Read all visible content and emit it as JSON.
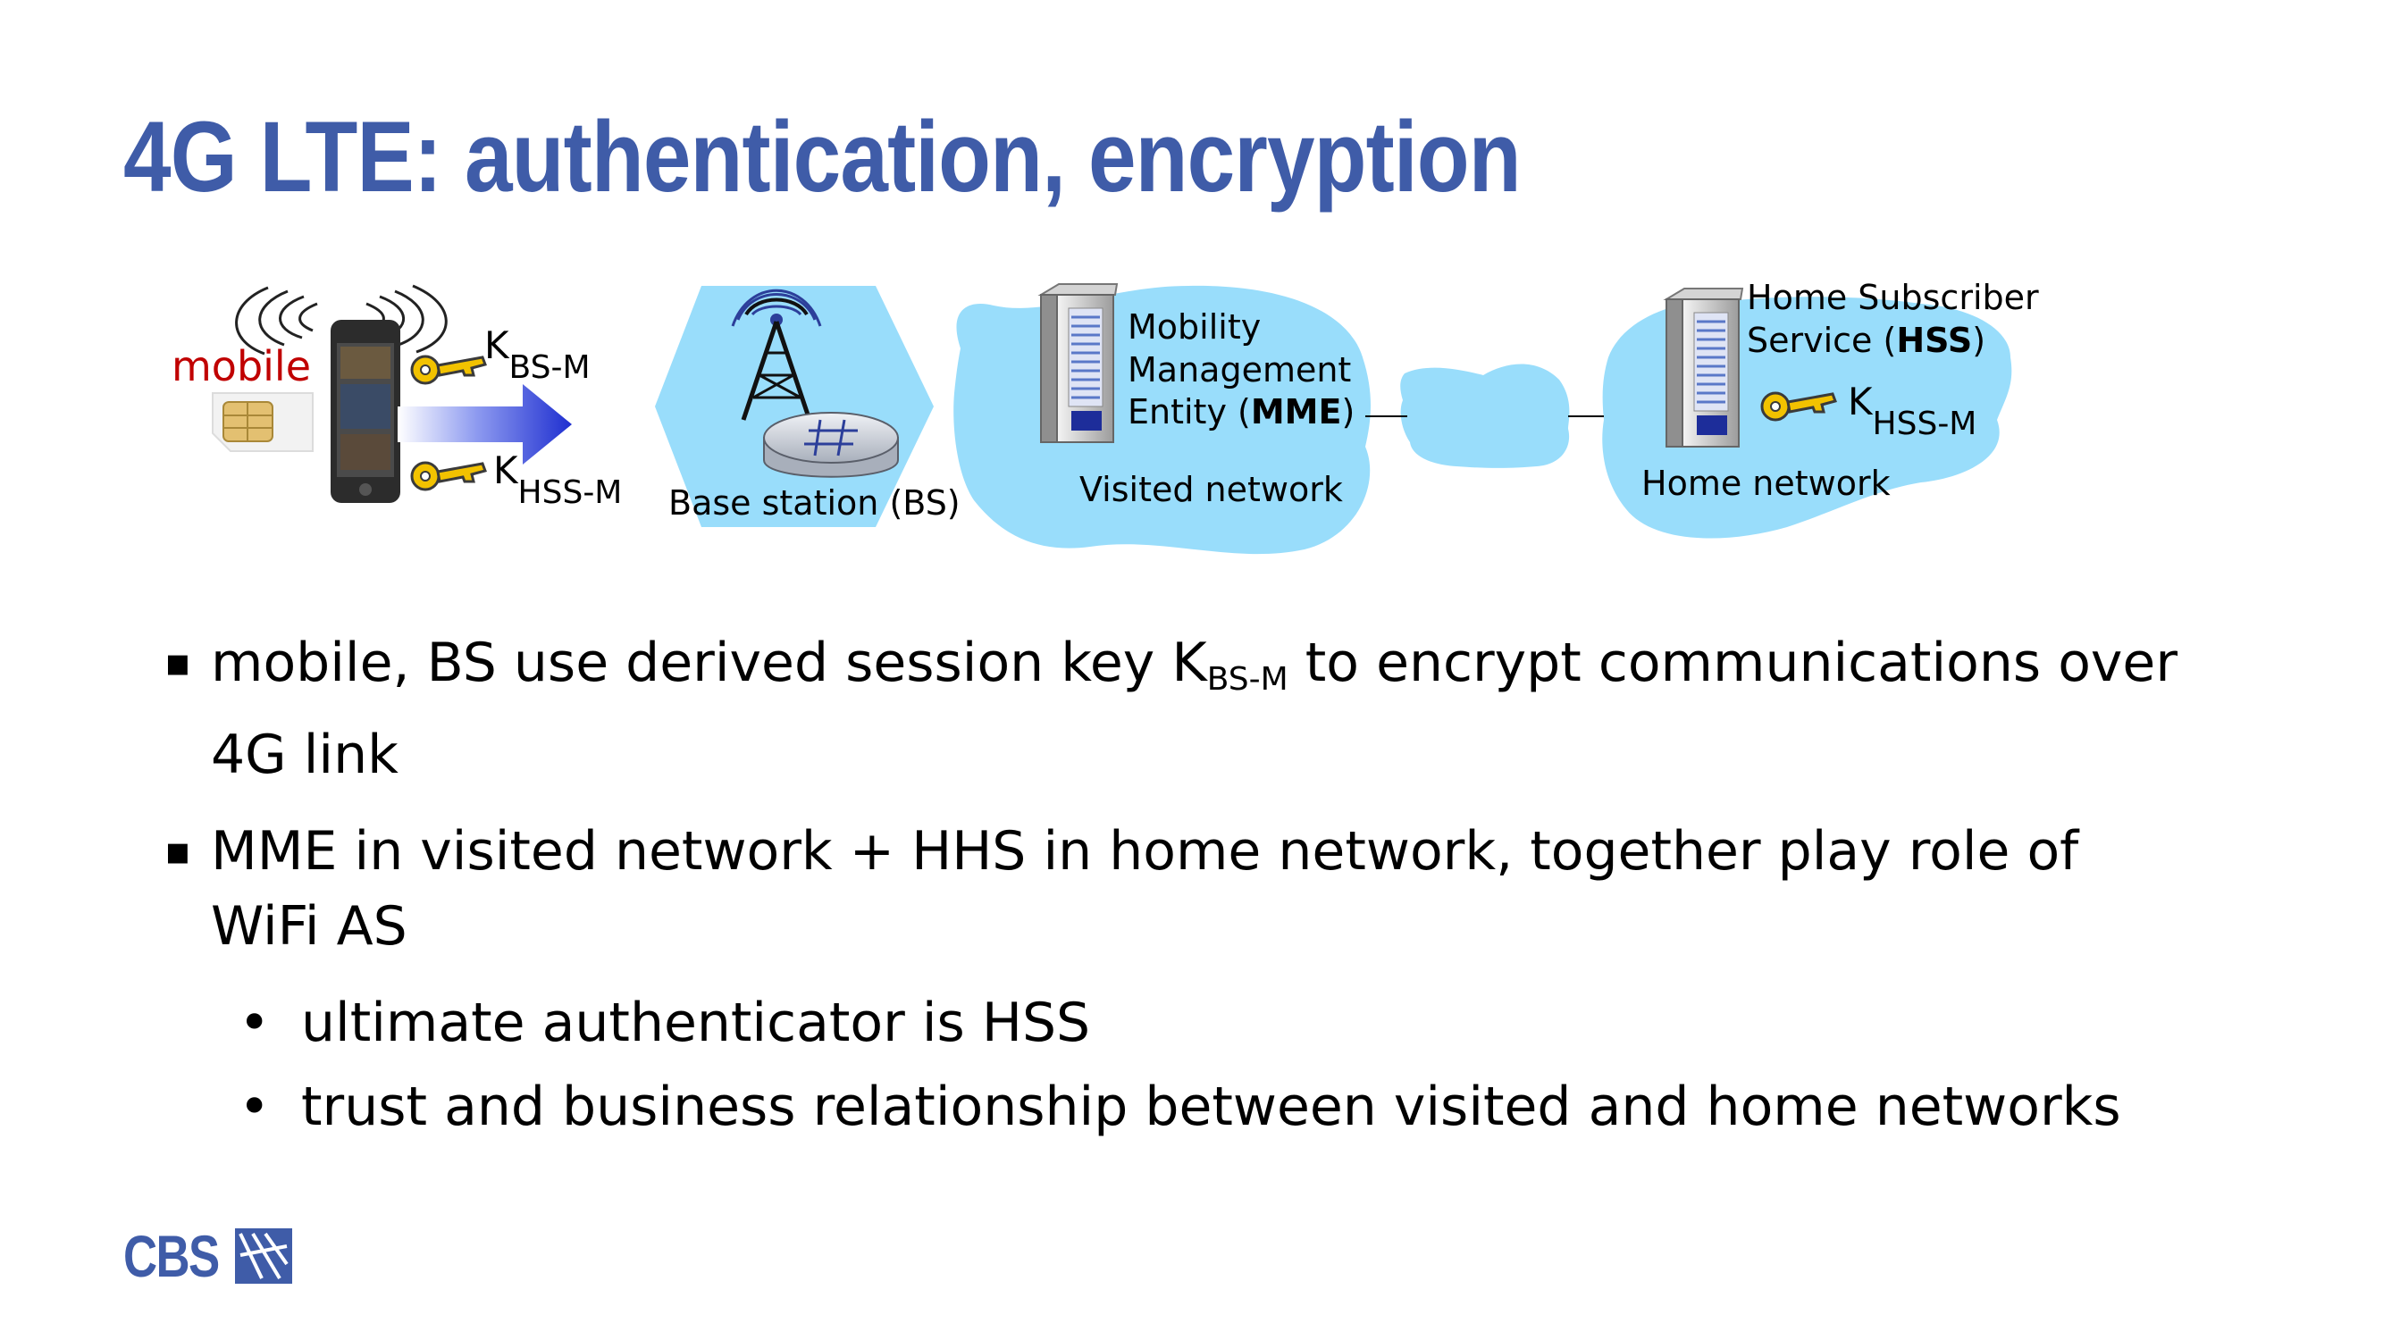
{
  "slide": {
    "title": "4G LTE: authentication, encryption",
    "logo_text": "CBS"
  },
  "diagram": {
    "mobile_label": "mobile",
    "key_bs_letter": "K",
    "key_bs_sub": "BS-M",
    "key_hss_letter": "K",
    "key_hss_sub": "HSS-M",
    "bs_label": "Base station (BS)",
    "mme_line1": "Mobility",
    "mme_line2": "Management",
    "mme_line3_pre": "Entity (",
    "mme_line3_bold": "MME",
    "mme_line3_post": ")",
    "visited_label": "Visited network",
    "hss_line1": "Home Subscriber",
    "hss_line2_pre": "Service (",
    "hss_line2_bold": "HSS",
    "hss_line2_post": ")",
    "hss_key_letter": "K",
    "hss_key_sub": "HSS-M",
    "home_label": "Home network"
  },
  "bullets": {
    "b1_pre": "mobile, BS use derived session key K",
    "b1_sub": "BS-M",
    "b1_post": " to encrypt communications over",
    "b1_line2": "4G link",
    "b2_line1": "MME in visited network + HHS in home network, together play role of",
    "b2_line2": "WiFi AS",
    "sub1": "ultimate authenticator is HSS",
    "sub2": "trust and business relationship between visited and home networks",
    "marker": "▪",
    "sub_marker": "•"
  },
  "colors": {
    "title": "#3f5ca8",
    "cloud": "#99ddfb",
    "mobile_label": "#c00000",
    "arrow": "#1f2fd0",
    "key": "#f2c200"
  }
}
